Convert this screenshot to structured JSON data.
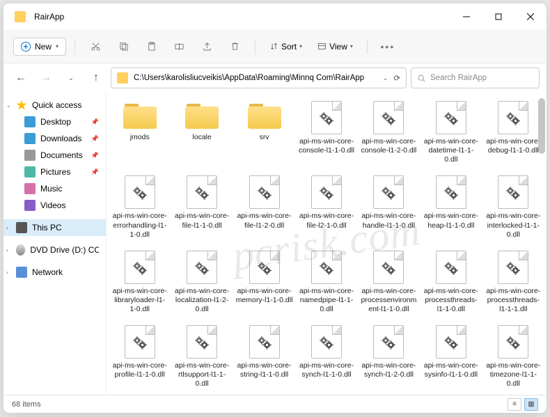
{
  "window": {
    "title": "RairApp"
  },
  "toolbar": {
    "new": "New",
    "sort": "Sort",
    "view": "View"
  },
  "address": {
    "path": "C:\\Users\\karolisliucveikis\\AppData\\Roaming\\Minnq Com\\RairApp"
  },
  "search": {
    "placeholder": "Search RairApp"
  },
  "sidebar": {
    "quick": "Quick access",
    "desktop": "Desktop",
    "downloads": "Downloads",
    "documents": "Documents",
    "pictures": "Pictures",
    "music": "Music",
    "videos": "Videos",
    "thispc": "This PC",
    "dvd": "DVD Drive (D:) CCCC",
    "network": "Network"
  },
  "items": [
    {
      "type": "folder",
      "name": "jmods"
    },
    {
      "type": "folder",
      "name": "locale"
    },
    {
      "type": "folder",
      "name": "srv"
    },
    {
      "type": "dll",
      "name": "api-ms-win-core-console-l1-1-0.dll"
    },
    {
      "type": "dll",
      "name": "api-ms-win-core-console-l1-2-0.dll"
    },
    {
      "type": "dll",
      "name": "api-ms-win-core-datetime-l1-1-0.dll"
    },
    {
      "type": "dll",
      "name": "api-ms-win-core-debug-l1-1-0.dll"
    },
    {
      "type": "dll",
      "name": "api-ms-win-core-errorhandling-l1-1-0.dll"
    },
    {
      "type": "dll",
      "name": "api-ms-win-core-file-l1-1-0.dll"
    },
    {
      "type": "dll",
      "name": "api-ms-win-core-file-l1-2-0.dll"
    },
    {
      "type": "dll",
      "name": "api-ms-win-core-file-l2-1-0.dll"
    },
    {
      "type": "dll",
      "name": "api-ms-win-core-handle-l1-1-0.dll"
    },
    {
      "type": "dll",
      "name": "api-ms-win-core-heap-l1-1-0.dll"
    },
    {
      "type": "dll",
      "name": "api-ms-win-core-interlocked-l1-1-0.dll"
    },
    {
      "type": "dll",
      "name": "api-ms-win-core-libraryloader-l1-1-0.dll"
    },
    {
      "type": "dll",
      "name": "api-ms-win-core-localization-l1-2-0.dll"
    },
    {
      "type": "dll",
      "name": "api-ms-win-core-memory-l1-1-0.dll"
    },
    {
      "type": "dll",
      "name": "api-ms-win-core-namedpipe-l1-1-0.dll"
    },
    {
      "type": "dll",
      "name": "api-ms-win-core-processenvironment-l1-1-0.dll"
    },
    {
      "type": "dll",
      "name": "api-ms-win-core-processthreads-l1-1-0.dll"
    },
    {
      "type": "dll",
      "name": "api-ms-win-core-processthreads-l1-1-1.dll"
    },
    {
      "type": "dll",
      "name": "api-ms-win-core-profile-l1-1-0.dll"
    },
    {
      "type": "dll",
      "name": "api-ms-win-core-rtlsupport-l1-1-0.dll"
    },
    {
      "type": "dll",
      "name": "api-ms-win-core-string-l1-1-0.dll"
    },
    {
      "type": "dll",
      "name": "api-ms-win-core-synch-l1-1-0.dll"
    },
    {
      "type": "dll",
      "name": "api-ms-win-core-synch-l1-2-0.dll"
    },
    {
      "type": "dll",
      "name": "api-ms-win-core-sysinfo-l1-1-0.dll"
    },
    {
      "type": "dll",
      "name": "api-ms-win-core-timezone-l1-1-0.dll"
    }
  ],
  "status": {
    "count": "68 items"
  },
  "watermark": "pcrisk.com"
}
